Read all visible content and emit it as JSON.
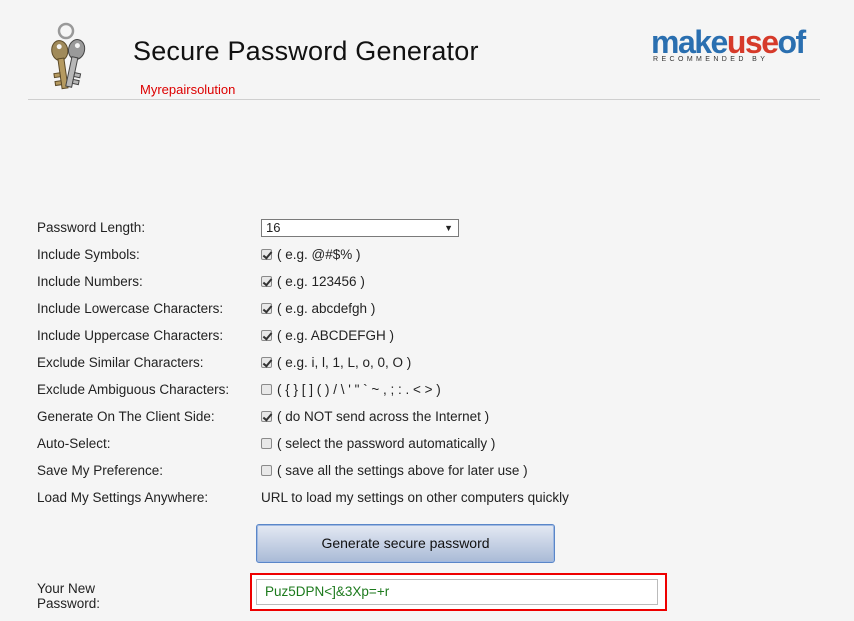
{
  "header": {
    "title": "Secure Password Generator",
    "subtitle": "Myrepairsolution",
    "logo": {
      "word_part1": "make",
      "word_part2": "use",
      "word_part3": "of",
      "tagline": "RECOMMENDED BY"
    }
  },
  "form": {
    "length": {
      "label": "Password Length:",
      "value": "16"
    },
    "symbols": {
      "label": "Include Symbols:",
      "hint": "( e.g. @#$% )",
      "checked": true
    },
    "numbers": {
      "label": "Include Numbers:",
      "hint": "( e.g. 123456 )",
      "checked": true
    },
    "lowercase": {
      "label": "Include Lowercase Characters:",
      "hint": "( e.g. abcdefgh )",
      "checked": true
    },
    "uppercase": {
      "label": "Include Uppercase Characters:",
      "hint": "( e.g. ABCDEFGH )",
      "checked": true
    },
    "similar": {
      "label": "Exclude Similar Characters:",
      "hint": "( e.g. i, l, 1, L, o, 0, O )",
      "checked": true
    },
    "ambiguous": {
      "label": "Exclude Ambiguous Characters:",
      "hint": "( { } [ ] ( ) / \\ ' \" ` ~ , ; : . < > )",
      "checked": false
    },
    "client_side": {
      "label": "Generate On The Client Side:",
      "hint": "( do NOT send across the Internet )",
      "checked": true
    },
    "auto_select": {
      "label": "Auto-Select:",
      "hint": "( select the password automatically )",
      "checked": false
    },
    "save_pref": {
      "label": "Save My Preference:",
      "hint": "( save all the settings above for later use )",
      "checked": false
    },
    "load_settings": {
      "label": "Load My Settings Anywhere:",
      "text": "URL to load my settings on other computers quickly"
    },
    "generate_label": "Generate secure password",
    "new_password": {
      "label": "Your New Password:",
      "value": "Puz5DPN<]&3Xp=+r"
    }
  }
}
